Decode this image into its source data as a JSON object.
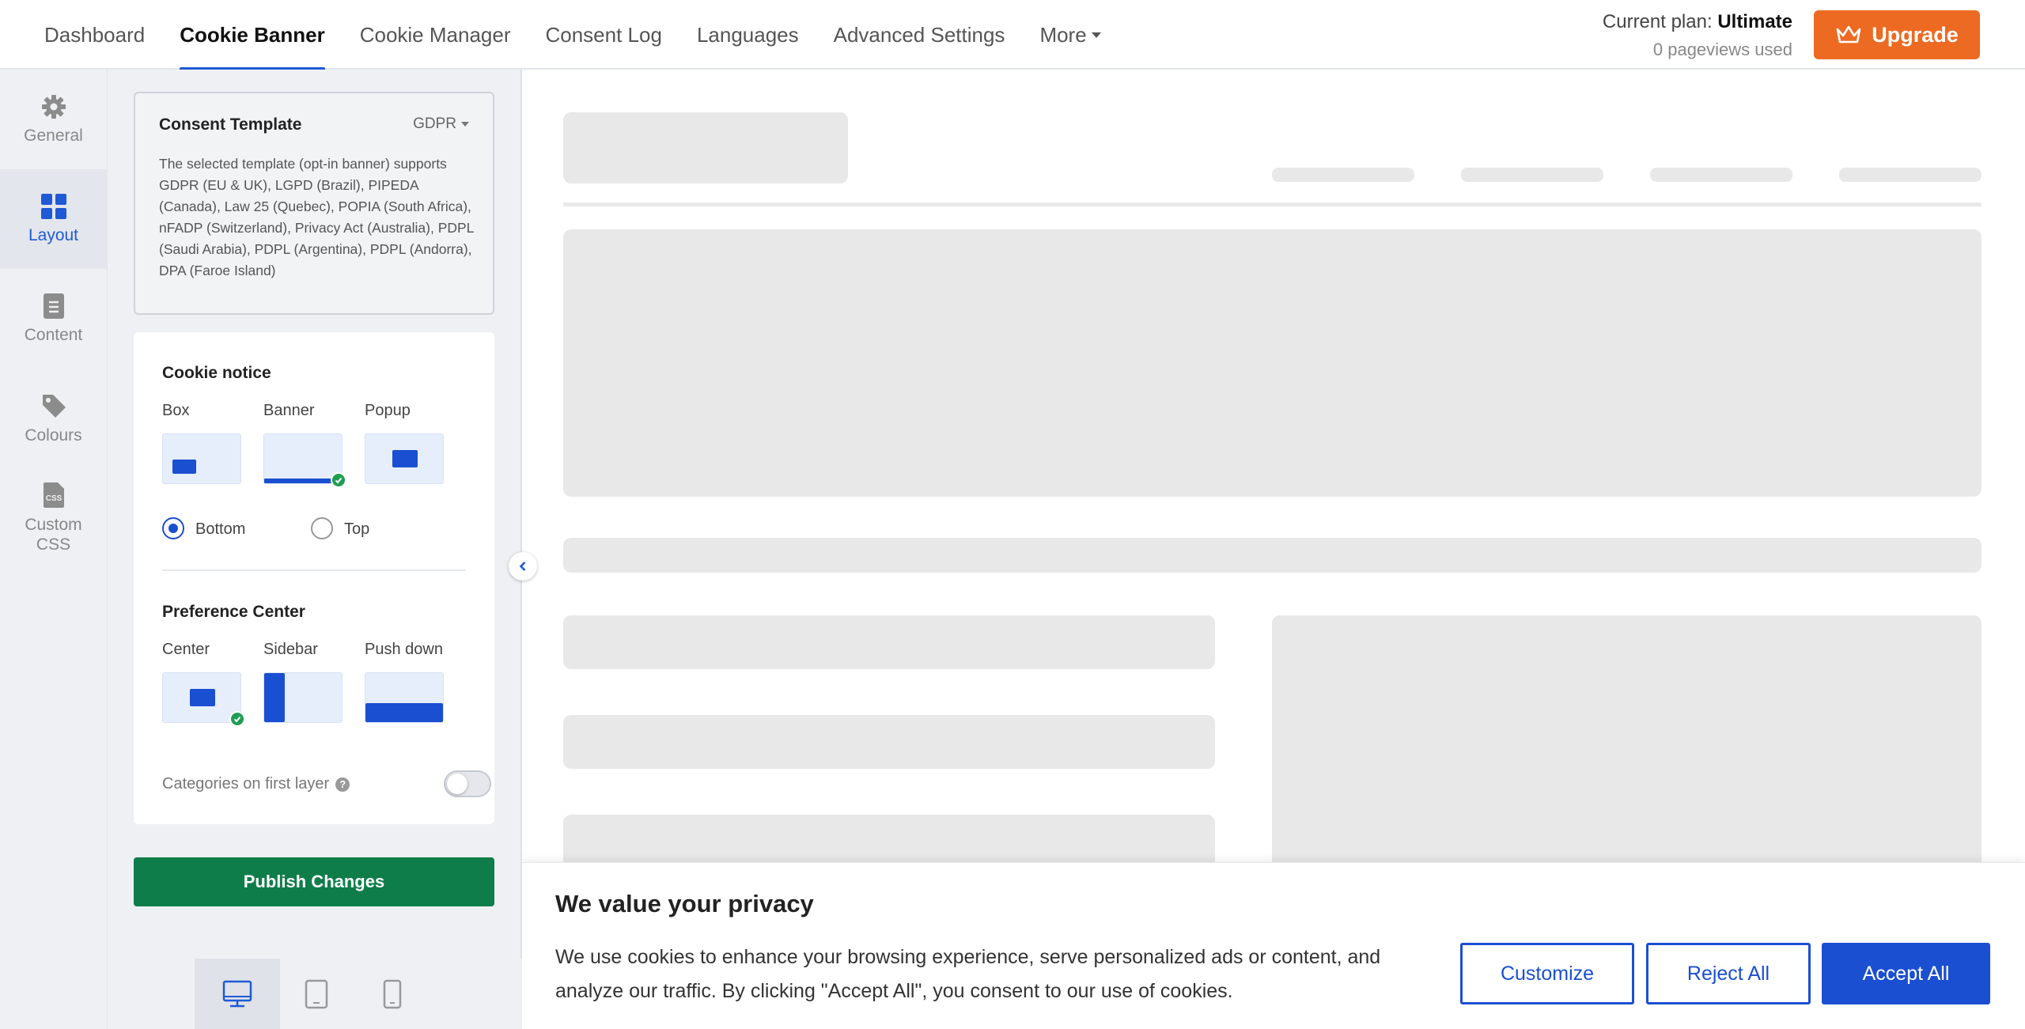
{
  "nav": {
    "tabs": [
      {
        "label": "Dashboard"
      },
      {
        "label": "Cookie Banner"
      },
      {
        "label": "Cookie Manager"
      },
      {
        "label": "Consent Log"
      },
      {
        "label": "Languages"
      },
      {
        "label": "Advanced Settings"
      },
      {
        "label": "More"
      }
    ],
    "active_tab": "Cookie Banner",
    "plan_prefix": "Current plan:",
    "plan_name": "Ultimate",
    "pageviews": "0 pageviews used",
    "upgrade_label": "Upgrade",
    "upgrade_icon": "crown-icon",
    "upgrade_color": "#ed6a22"
  },
  "rail": {
    "items": [
      {
        "label": "General",
        "icon": "gear-icon"
      },
      {
        "label": "Layout",
        "icon": "grid-icon"
      },
      {
        "label": "Content",
        "icon": "document-icon"
      },
      {
        "label": "Colours",
        "icon": "paint-tag-icon"
      },
      {
        "label": "Custom CSS",
        "icon": "css-file-icon"
      }
    ],
    "active": "Layout"
  },
  "template": {
    "title": "Consent Template",
    "selected": "GDPR",
    "description": "The selected template (opt-in banner) supports GDPR (EU & UK), LGPD (Brazil), PIPEDA (Canada), Law 25 (Quebec), POPIA (South Africa), nFADP (Switzerland), Privacy Act (Australia), PDPL (Saudi Arabia), PDPL (Argentina), PDPL (Andorra), DPA (Faroe Island)"
  },
  "cookie_notice": {
    "title": "Cookie notice",
    "options": [
      "Box",
      "Banner",
      "Popup"
    ],
    "selected": "Banner",
    "positions": [
      "Bottom",
      "Top"
    ],
    "selected_position": "Bottom"
  },
  "preference_center": {
    "title": "Preference Center",
    "options": [
      "Center",
      "Sidebar",
      "Push down"
    ],
    "selected": "Center",
    "categories_label": "Categories on first layer",
    "categories_on": false
  },
  "publish_label": "Publish Changes",
  "publish_color": "#0f7d4a",
  "devices": [
    {
      "name": "desktop-icon",
      "active": true
    },
    {
      "name": "tablet-icon",
      "active": false
    },
    {
      "name": "mobile-icon",
      "active": false
    }
  ],
  "banner": {
    "title": "We value your privacy",
    "text": "We use cookies to enhance your browsing experience, serve personalized ads or content, and analyze our traffic. By clicking \"Accept All\", you consent to our use of cookies.",
    "customize": "Customize",
    "reject": "Reject All",
    "accept": "Accept All",
    "accent": "#1b4fd1"
  }
}
